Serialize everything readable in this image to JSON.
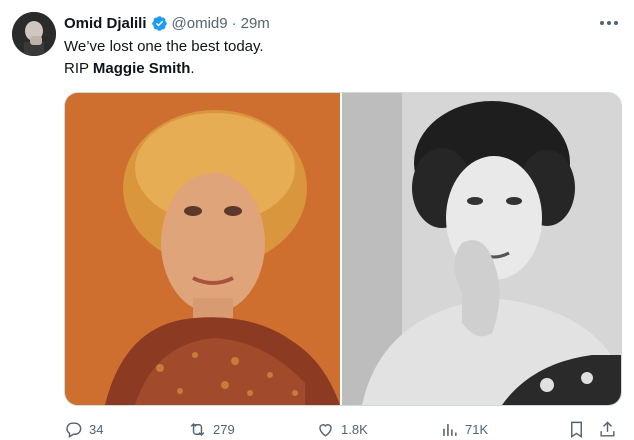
{
  "tweet": {
    "author_name": "Omid Djalili",
    "handle": "@omid9",
    "separator": "·",
    "time": "29m",
    "text_line1": "We’ve lost one the best today.",
    "text_prefix": "RIP ",
    "text_bold": "Maggie Smith",
    "text_suffix": "."
  },
  "actions": {
    "replies": "34",
    "retweets": "279",
    "likes": "1.8K",
    "views": "71K"
  },
  "colors": {
    "text": "#0f1419",
    "muted": "#536471",
    "verified": "#1d9bf0",
    "left_photo_bg": "#c96a2a"
  },
  "icons": [
    "verified-badge-icon",
    "more-icon",
    "reply-icon",
    "retweet-icon",
    "like-icon",
    "views-icon",
    "bookmark-icon",
    "share-icon"
  ]
}
